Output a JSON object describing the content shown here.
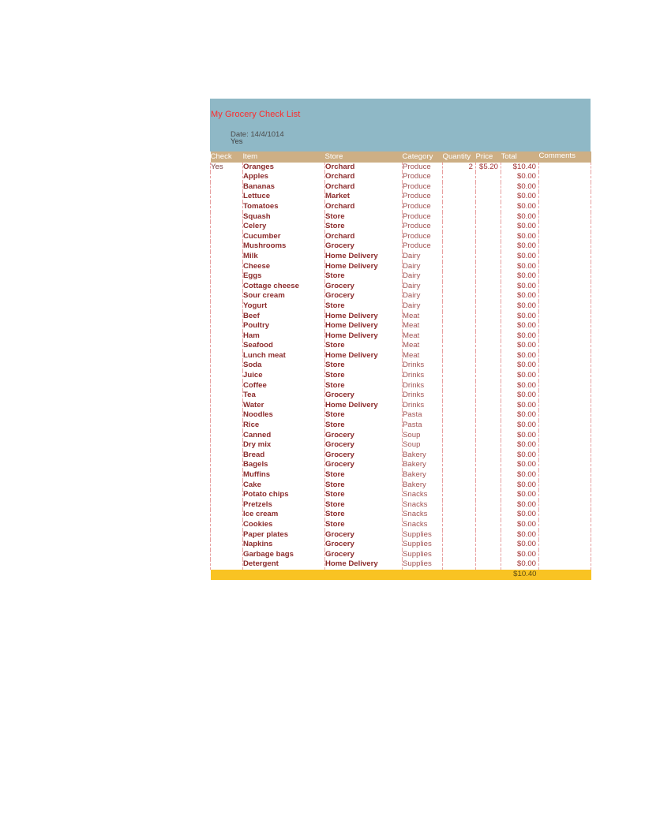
{
  "document": {
    "title": "My Grocery Check List",
    "date_label": "Date: 14/4/1014",
    "date_status": "Yes"
  },
  "colors": {
    "title_band": "#8fb8c6",
    "title_text": "#ff2a2a",
    "header_band": "#cdaf85",
    "footer_band": "#f9c323",
    "grid_line": "#e8a0a0",
    "item_text": "#8b2b2b"
  },
  "table": {
    "columns": [
      "Check",
      "Item",
      "Store",
      "Category",
      "Quantity",
      "Price",
      "Total",
      "Comments"
    ],
    "rows": [
      {
        "check": "Yes",
        "item": "Oranges",
        "store": "Orchard",
        "category": "Produce",
        "quantity": "2",
        "price": "$5.20",
        "total": "$10.40",
        "comments": ""
      },
      {
        "check": "",
        "item": "Apples",
        "store": "Orchard",
        "category": "Produce",
        "quantity": "",
        "price": "",
        "total": "$0.00",
        "comments": ""
      },
      {
        "check": "",
        "item": "Bananas",
        "store": "Orchard",
        "category": "Produce",
        "quantity": "",
        "price": "",
        "total": "$0.00",
        "comments": ""
      },
      {
        "check": "",
        "item": "Lettuce",
        "store": "Market",
        "category": "Produce",
        "quantity": "",
        "price": "",
        "total": "$0.00",
        "comments": ""
      },
      {
        "check": "",
        "item": "Tomatoes",
        "store": "Orchard",
        "category": "Produce",
        "quantity": "",
        "price": "",
        "total": "$0.00",
        "comments": ""
      },
      {
        "check": "",
        "item": "Squash",
        "store": "Store",
        "category": "Produce",
        "quantity": "",
        "price": "",
        "total": "$0.00",
        "comments": ""
      },
      {
        "check": "",
        "item": "Celery",
        "store": "Store",
        "category": "Produce",
        "quantity": "",
        "price": "",
        "total": "$0.00",
        "comments": ""
      },
      {
        "check": "",
        "item": "Cucumber",
        "store": "Orchard",
        "category": "Produce",
        "quantity": "",
        "price": "",
        "total": "$0.00",
        "comments": ""
      },
      {
        "check": "",
        "item": "Mushrooms",
        "store": "Grocery",
        "category": "Produce",
        "quantity": "",
        "price": "",
        "total": "$0.00",
        "comments": ""
      },
      {
        "check": "",
        "item": "Milk",
        "store": "Home Delivery",
        "category": "Dairy",
        "quantity": "",
        "price": "",
        "total": "$0.00",
        "comments": ""
      },
      {
        "check": "",
        "item": "Cheese",
        "store": "Home Delivery",
        "category": "Dairy",
        "quantity": "",
        "price": "",
        "total": "$0.00",
        "comments": ""
      },
      {
        "check": "",
        "item": "Eggs",
        "store": "Store",
        "category": "Dairy",
        "quantity": "",
        "price": "",
        "total": "$0.00",
        "comments": ""
      },
      {
        "check": "",
        "item": "Cottage cheese",
        "store": "Grocery",
        "category": "Dairy",
        "quantity": "",
        "price": "",
        "total": "$0.00",
        "comments": ""
      },
      {
        "check": "",
        "item": "Sour cream",
        "store": "Grocery",
        "category": "Dairy",
        "quantity": "",
        "price": "",
        "total": "$0.00",
        "comments": ""
      },
      {
        "check": "",
        "item": "Yogurt",
        "store": "Store",
        "category": "Dairy",
        "quantity": "",
        "price": "",
        "total": "$0.00",
        "comments": ""
      },
      {
        "check": "",
        "item": "Beef",
        "store": "Home Delivery",
        "category": "Meat",
        "quantity": "",
        "price": "",
        "total": "$0.00",
        "comments": ""
      },
      {
        "check": "",
        "item": "Poultry",
        "store": "Home Delivery",
        "category": "Meat",
        "quantity": "",
        "price": "",
        "total": "$0.00",
        "comments": ""
      },
      {
        "check": "",
        "item": "Ham",
        "store": "Home Delivery",
        "category": "Meat",
        "quantity": "",
        "price": "",
        "total": "$0.00",
        "comments": ""
      },
      {
        "check": "",
        "item": "Seafood",
        "store": "Store",
        "category": "Meat",
        "quantity": "",
        "price": "",
        "total": "$0.00",
        "comments": ""
      },
      {
        "check": "",
        "item": "Lunch meat",
        "store": "Home Delivery",
        "category": "Meat",
        "quantity": "",
        "price": "",
        "total": "$0.00",
        "comments": ""
      },
      {
        "check": "",
        "item": "Soda",
        "store": "Store",
        "category": "Drinks",
        "quantity": "",
        "price": "",
        "total": "$0.00",
        "comments": ""
      },
      {
        "check": "",
        "item": "Juice",
        "store": "Store",
        "category": "Drinks",
        "quantity": "",
        "price": "",
        "total": "$0.00",
        "comments": ""
      },
      {
        "check": "",
        "item": "Coffee",
        "store": "Store",
        "category": "Drinks",
        "quantity": "",
        "price": "",
        "total": "$0.00",
        "comments": ""
      },
      {
        "check": "",
        "item": "Tea",
        "store": "Grocery",
        "category": "Drinks",
        "quantity": "",
        "price": "",
        "total": "$0.00",
        "comments": ""
      },
      {
        "check": "",
        "item": "Water",
        "store": "Home Delivery",
        "category": "Drinks",
        "quantity": "",
        "price": "",
        "total": "$0.00",
        "comments": ""
      },
      {
        "check": "",
        "item": "Noodles",
        "store": "Store",
        "category": "Pasta",
        "quantity": "",
        "price": "",
        "total": "$0.00",
        "comments": ""
      },
      {
        "check": "",
        "item": "Rice",
        "store": "Store",
        "category": "Pasta",
        "quantity": "",
        "price": "",
        "total": "$0.00",
        "comments": ""
      },
      {
        "check": "",
        "item": "Canned",
        "store": "Grocery",
        "category": "Soup",
        "quantity": "",
        "price": "",
        "total": "$0.00",
        "comments": ""
      },
      {
        "check": "",
        "item": "Dry mix",
        "store": "Grocery",
        "category": "Soup",
        "quantity": "",
        "price": "",
        "total": "$0.00",
        "comments": ""
      },
      {
        "check": "",
        "item": "Bread",
        "store": "Grocery",
        "category": "Bakery",
        "quantity": "",
        "price": "",
        "total": "$0.00",
        "comments": ""
      },
      {
        "check": "",
        "item": "Bagels",
        "store": "Grocery",
        "category": "Bakery",
        "quantity": "",
        "price": "",
        "total": "$0.00",
        "comments": ""
      },
      {
        "check": "",
        "item": "Muffins",
        "store": "Store",
        "category": "Bakery",
        "quantity": "",
        "price": "",
        "total": "$0.00",
        "comments": ""
      },
      {
        "check": "",
        "item": "Cake",
        "store": "Store",
        "category": "Bakery",
        "quantity": "",
        "price": "",
        "total": "$0.00",
        "comments": ""
      },
      {
        "check": "",
        "item": "Potato chips",
        "store": "Store",
        "category": "Snacks",
        "quantity": "",
        "price": "",
        "total": "$0.00",
        "comments": ""
      },
      {
        "check": "",
        "item": "Pretzels",
        "store": "Store",
        "category": "Snacks",
        "quantity": "",
        "price": "",
        "total": "$0.00",
        "comments": ""
      },
      {
        "check": "",
        "item": "Ice cream",
        "store": "Store",
        "category": "Snacks",
        "quantity": "",
        "price": "",
        "total": "$0.00",
        "comments": ""
      },
      {
        "check": "",
        "item": "Cookies",
        "store": "Store",
        "category": "Snacks",
        "quantity": "",
        "price": "",
        "total": "$0.00",
        "comments": ""
      },
      {
        "check": "",
        "item": "Paper plates",
        "store": "Grocery",
        "category": "Supplies",
        "quantity": "",
        "price": "",
        "total": "$0.00",
        "comments": ""
      },
      {
        "check": "",
        "item": "Napkins",
        "store": "Grocery",
        "category": "Supplies",
        "quantity": "",
        "price": "",
        "total": "$0.00",
        "comments": ""
      },
      {
        "check": "",
        "item": "Garbage bags",
        "store": "Grocery",
        "category": "Supplies",
        "quantity": "",
        "price": "",
        "total": "$0.00",
        "comments": ""
      },
      {
        "check": "",
        "item": "Detergent",
        "store": "Home Delivery",
        "category": "Supplies",
        "quantity": "",
        "price": "",
        "total": "$0.00",
        "comments": ""
      }
    ],
    "footer": {
      "grand_total": "$10.40"
    }
  }
}
